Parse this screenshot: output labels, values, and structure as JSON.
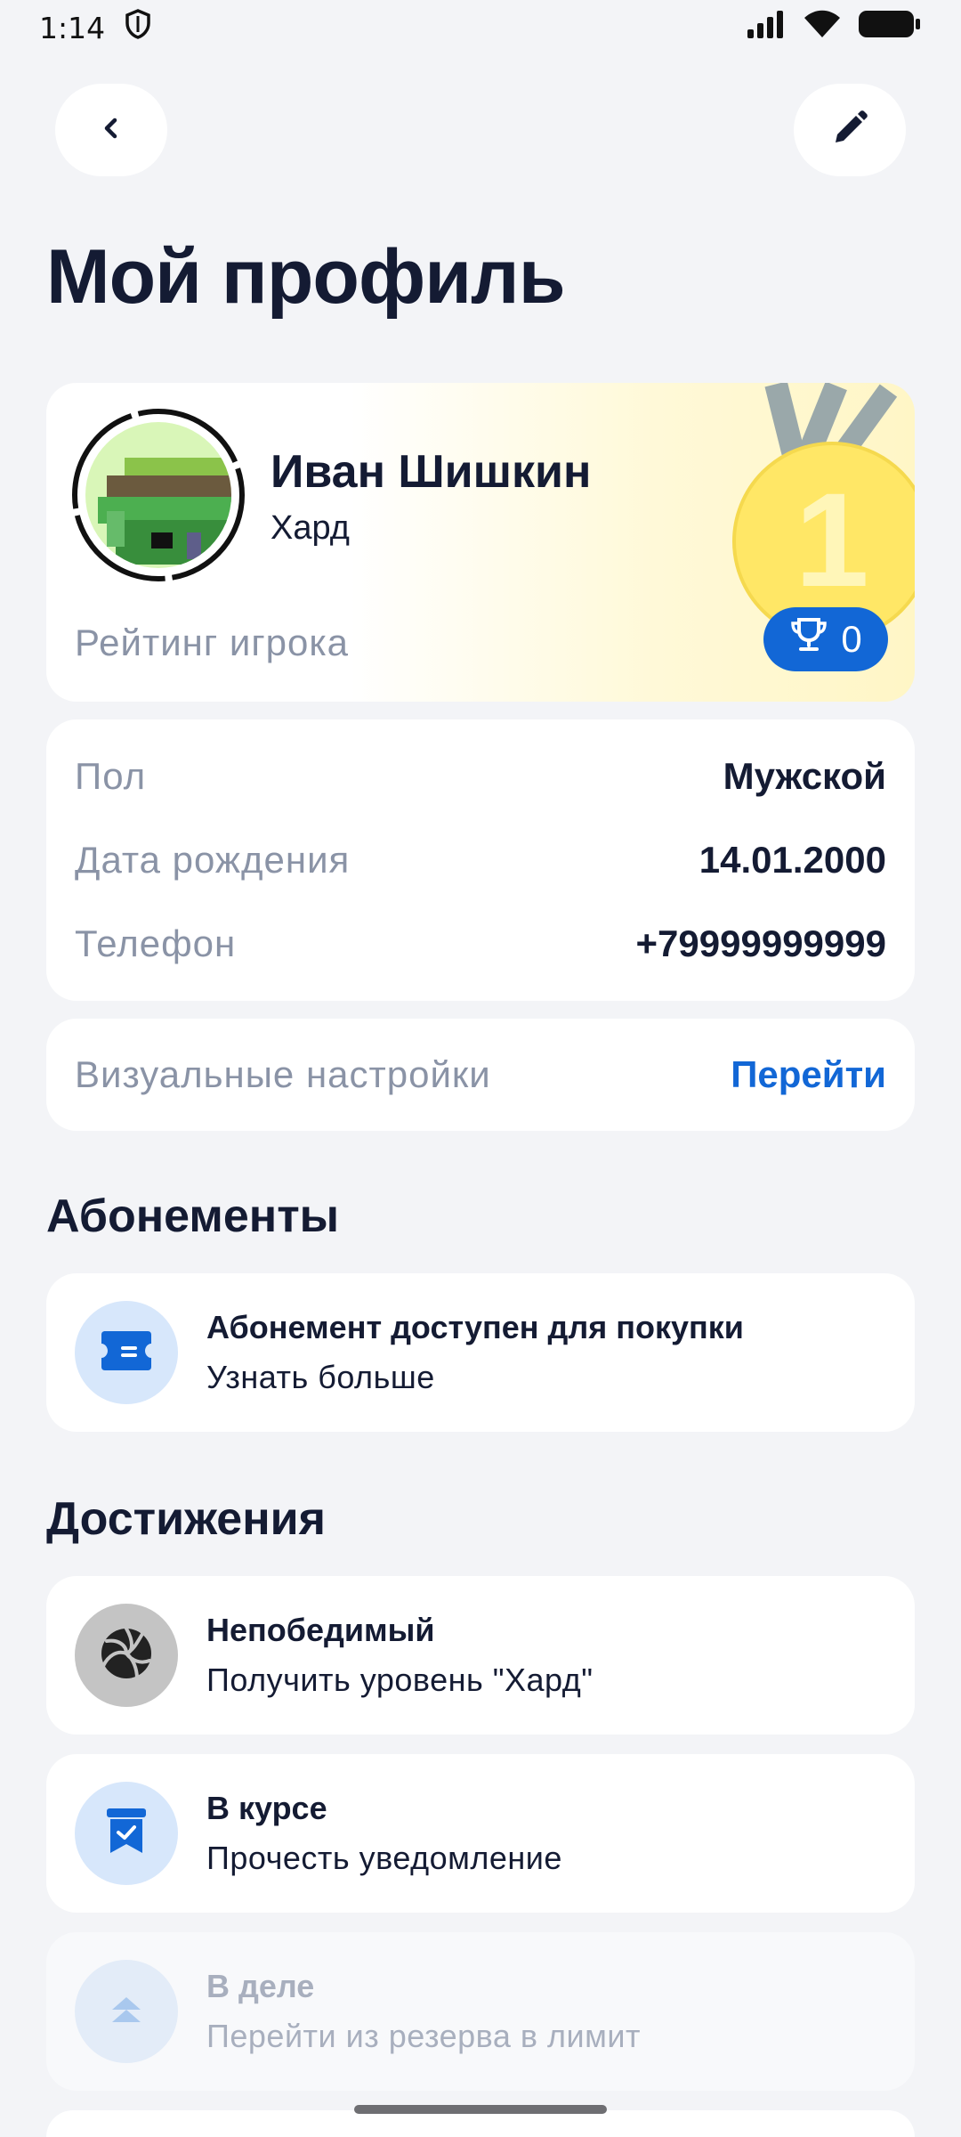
{
  "status_bar": {
    "time": "1:14"
  },
  "header": {
    "title": "Мой профиль"
  },
  "profile": {
    "name": "Иван Шишкин",
    "level": "Хард",
    "rating_label": "Рейтинг игрока",
    "medal_rank": "1",
    "rating_value": "0"
  },
  "info": {
    "rows": [
      {
        "label": "Пол",
        "value": "Мужской"
      },
      {
        "label": "Дата рождения",
        "value": "14.01.2000"
      },
      {
        "label": "Телефон",
        "value": "+79999999999"
      }
    ]
  },
  "visual_settings": {
    "label": "Визуальные настройки",
    "action": "Перейти"
  },
  "subscriptions": {
    "title": "Абонементы",
    "item": {
      "title": "Абонемент доступен для покупки",
      "subtitle": "Узнать больше"
    }
  },
  "achievements": {
    "title": "Достижения",
    "items": [
      {
        "title": "Непобедимый",
        "subtitle": "Получить уровень \"Хард\""
      },
      {
        "title": "В курсе",
        "subtitle": "Прочесть уведомление"
      },
      {
        "title": "В деле",
        "subtitle": "Перейти из резерва в лимит"
      }
    ]
  },
  "colors": {
    "accent": "#1267D6",
    "text": "#141B33",
    "muted": "#8A93A6",
    "background": "#F3F4F7"
  },
  "icons": [
    "back-icon",
    "edit-icon",
    "trophy-icon",
    "ticket-icon",
    "volleyball-icon",
    "bookmark-check-icon",
    "chevrons-up-icon"
  ]
}
